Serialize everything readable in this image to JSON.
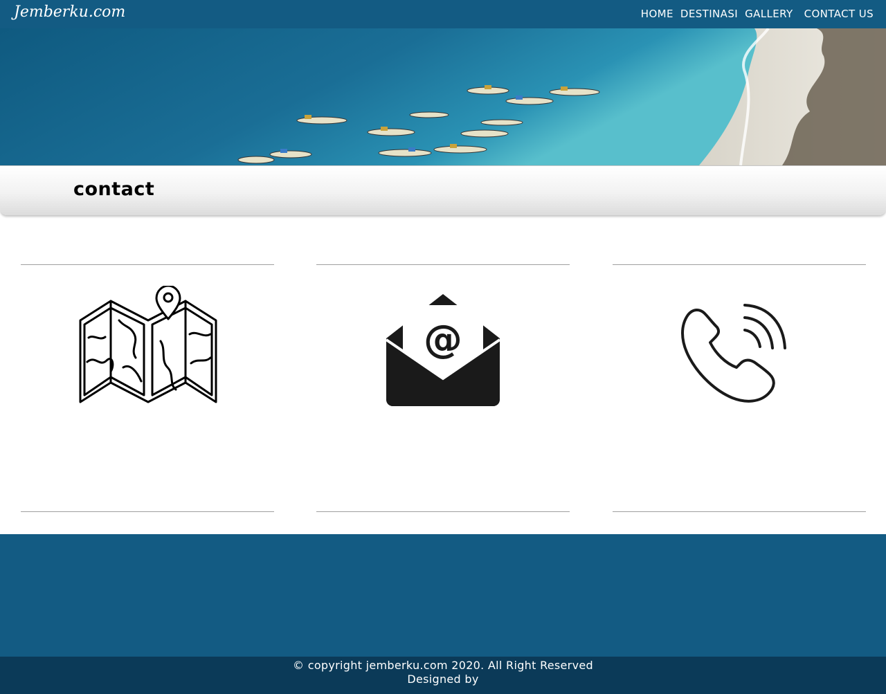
{
  "header": {
    "brand": "Jemberku.com",
    "nav": [
      {
        "label": "HOME"
      },
      {
        "label": "DESTINASI"
      },
      {
        "label": "GALLERY"
      },
      {
        "label": "CONTACT US"
      }
    ]
  },
  "hero": {
    "image": "beach-with-boats-photo"
  },
  "page": {
    "title": "contact"
  },
  "contact_cards": [
    {
      "icon": "map-icon"
    },
    {
      "icon": "email-icon"
    },
    {
      "icon": "phone-icon"
    }
  ],
  "footer": {
    "copyright": "© copyright jemberku.com 2020. All Right Reserved",
    "designed_by": "Designed by"
  },
  "colors": {
    "nav_bg": "#135b83",
    "footer_bg": "#135b83",
    "copyright_bg": "#0b3a58"
  }
}
